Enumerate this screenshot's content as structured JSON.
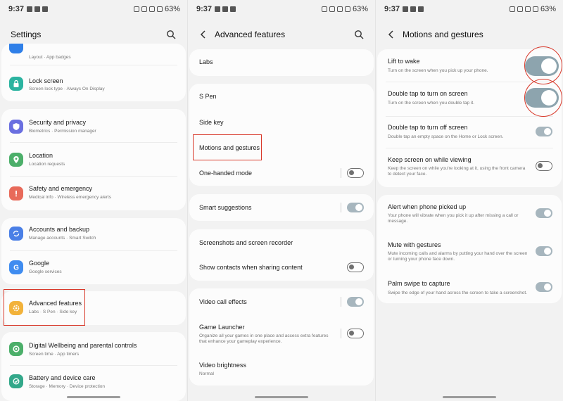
{
  "status": {
    "time": "9:37",
    "battery": "63%"
  },
  "panel1": {
    "title": "Settings",
    "partial_item": {
      "label": "",
      "sub": "Layout · App badges"
    },
    "items": [
      {
        "label": "Lock screen",
        "sub": "Screen lock type · Always On Display",
        "icon": "lock-icon",
        "color": "#2bb3a0"
      },
      {
        "label": "Security and privacy",
        "sub": "Biometrics · Permission manager",
        "icon": "shield-icon",
        "color": "#6a6fe0"
      },
      {
        "label": "Location",
        "sub": "Location requests",
        "icon": "location-pin-icon",
        "color": "#4caf6a"
      },
      {
        "label": "Safety and emergency",
        "sub": "Medical info · Wireless emergency alerts",
        "icon": "alert-icon",
        "color": "#e86a5a"
      },
      {
        "label": "Accounts and backup",
        "sub": "Manage accounts · Smart Switch",
        "icon": "sync-icon",
        "color": "#4a7fe6"
      },
      {
        "label": "Google",
        "sub": "Google services",
        "icon": "google-icon",
        "color": "#3f8cf0"
      },
      {
        "label": "Advanced features",
        "sub": "Labs · S Pen · Side key",
        "icon": "gear-plus-icon",
        "color": "#f2b23a"
      },
      {
        "label": "Digital Wellbeing and parental controls",
        "sub": "Screen time · App timers",
        "icon": "wellbeing-icon",
        "color": "#4caf6a"
      },
      {
        "label": "Battery and device care",
        "sub": "Storage · Memory · Device protection",
        "icon": "device-care-icon",
        "color": "#33a88a"
      }
    ]
  },
  "panel2": {
    "title": "Advanced features",
    "items": [
      {
        "label": "Labs"
      },
      {
        "label": "S Pen"
      },
      {
        "label": "Side key"
      },
      {
        "label": "Motions and gestures"
      },
      {
        "label": "One-handed mode",
        "toggle": "off"
      },
      {
        "label": "Smart suggestions",
        "toggle": "on"
      },
      {
        "label": "Screenshots and screen recorder"
      },
      {
        "label": "Show contacts when sharing content",
        "toggle": "off"
      },
      {
        "label": "Video call effects",
        "toggle": "on"
      },
      {
        "label": "Game Launcher",
        "sub": "Organize all your games in one place and access extra features that enhance your gameplay experience.",
        "toggle": "off"
      },
      {
        "label": "Video brightness",
        "sub": "Normal"
      }
    ]
  },
  "panel3": {
    "title": "Motions and gestures",
    "items": [
      {
        "label": "Lift to wake",
        "sub": "Turn on the screen when you pick up your phone.",
        "toggle": "on"
      },
      {
        "label": "Double tap to turn on screen",
        "sub": "Turn on the screen when you double tap it.",
        "toggle": "on"
      },
      {
        "label": "Double tap to turn off screen",
        "sub": "Double tap an empty space on the Home or Lock screen.",
        "toggle": "on"
      },
      {
        "label": "Keep screen on while viewing",
        "sub": "Keep the screen on while you're looking at it, using the front camera to detect your face.",
        "toggle": "off"
      },
      {
        "label": "Alert when phone picked up",
        "sub": "Your phone will vibrate when you pick it up after missing a call or message.",
        "toggle": "on"
      },
      {
        "label": "Mute with gestures",
        "sub": "Mute incoming calls and alarms by putting your hand over the screen or turning your phone face down.",
        "toggle": "on"
      },
      {
        "label": "Palm swipe to capture",
        "sub": "Swipe the edge of your hand across the screen to take a screenshot.",
        "toggle": "on"
      }
    ]
  },
  "colors": {
    "highlight": "#d8392b",
    "toggle_on": "#a7b6be",
    "toggle_off": "#707070"
  }
}
